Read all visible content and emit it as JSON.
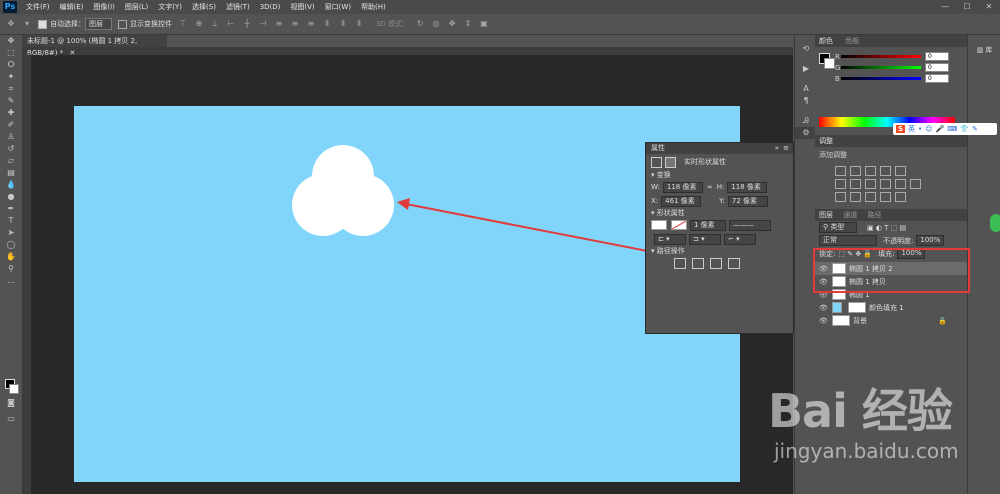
{
  "menubar": {
    "logo": "Ps",
    "items": [
      "文件(F)",
      "编辑(E)",
      "图像(I)",
      "图层(L)",
      "文字(Y)",
      "选择(S)",
      "滤镜(T)",
      "3D(D)",
      "视图(V)",
      "窗口(W)",
      "帮助(H)"
    ]
  },
  "options": {
    "auto_select_label": "自动选择：",
    "auto_select_value": "图层",
    "show_transform_label": "显示变换控件",
    "mode_3d_label": "3D 模式："
  },
  "document": {
    "tab_title": "未标题-1 @ 100% (椭圆 1 拷贝 2, RGB/8#) *"
  },
  "properties": {
    "title": "属性",
    "subtitle": "实时形状属性",
    "section_transform": "变换",
    "w_label": "W:",
    "w_value": "118 像素",
    "h_label": "H:",
    "h_value": "118 像素",
    "x_label": "X:",
    "x_value": "461 像素",
    "y_label": "Y:",
    "y_value": "72 像素",
    "section_shape": "形状属性",
    "stroke_width": "1 像素",
    "section_path": "路径操作"
  },
  "color_panel": {
    "tabs": [
      "颜色",
      "色板"
    ],
    "r": "0",
    "g": "0",
    "b": "0"
  },
  "adjust_panel": {
    "tab": "调整",
    "add_label": "添加调整"
  },
  "layers_panel": {
    "tabs": [
      "图层",
      "通道",
      "路径"
    ],
    "filter_kind": "类型",
    "blend_mode": "正常",
    "opacity_label": "不透明度:",
    "opacity_value": "100%",
    "lock_label": "锁定:",
    "fill_label": "填充:",
    "fill_value": "100%",
    "layers": [
      {
        "name": "椭圆 1 拷贝 2",
        "active": true
      },
      {
        "name": "椭圆 1 拷贝",
        "active": false
      },
      {
        "name": "椭圆 1",
        "active": false
      },
      {
        "name": "颜色填充 1",
        "active": false
      },
      {
        "name": "背景",
        "active": false
      }
    ]
  },
  "library": {
    "label": "库"
  },
  "ime": {
    "label": "英"
  },
  "watermark": {
    "logo": "Bai 经验",
    "url": "jingyan.baidu.com"
  },
  "colors": {
    "canvas": "#82d5fa",
    "accent_red": "#e23b3b"
  }
}
